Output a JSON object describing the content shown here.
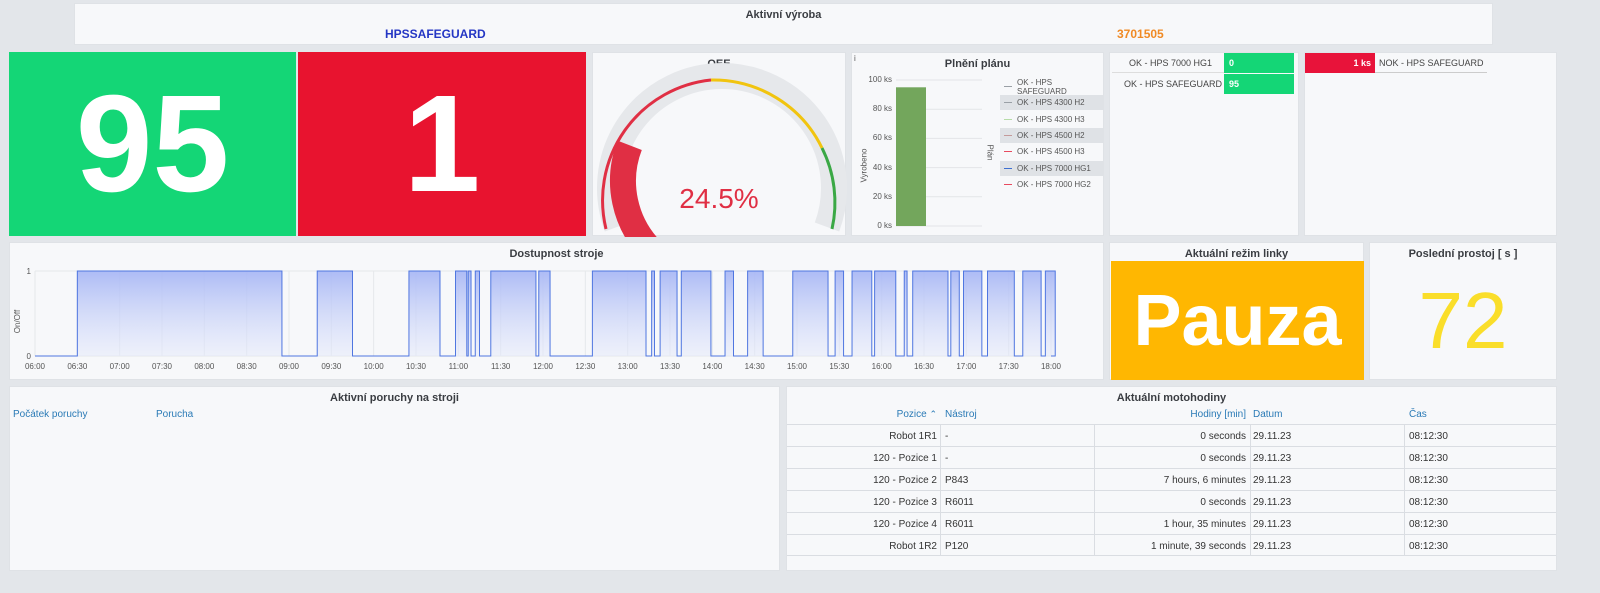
{
  "header": {
    "title": "Aktivní výroba",
    "product": "HPSSAFEGUARD",
    "order": "3701505"
  },
  "stat_ok": {
    "value": "95",
    "color": "#14d676"
  },
  "stat_nok": {
    "value": "1",
    "color": "#e8132f"
  },
  "oee": {
    "title": "OEE",
    "value": "24.5%",
    "percent": 24.5
  },
  "plan": {
    "title": "Plnění plánu",
    "info": "i",
    "ylabel_left": "Vyrobeno",
    "ylabel_right": "Plán",
    "ticks": [
      "100 ks",
      "80 ks",
      "60 ks",
      "40 ks",
      "20 ks",
      "0 ks"
    ],
    "bar_value": 95,
    "ymax": 100,
    "legend": [
      {
        "label": "OK - HPS SAFEGUARD",
        "color": "#9aa0a6",
        "hl": false
      },
      {
        "label": "OK - HPS 4300 H2",
        "color": "#9aa0a6",
        "hl": true
      },
      {
        "label": "OK - HPS 4300 H3",
        "color": "#b7dca8",
        "hl": false
      },
      {
        "label": "OK - HPS 4500 H2",
        "color": "#c49a9a",
        "hl": true
      },
      {
        "label": "OK - HPS 4500 H3",
        "color": "#e84a5f",
        "hl": false
      },
      {
        "label": "OK - HPS 7000 HG1",
        "color": "#3d6fd1",
        "hl": true
      },
      {
        "label": "OK - HPS 7000 HG2",
        "color": "#e84a5f",
        "hl": false
      }
    ]
  },
  "ok_table": {
    "rows": [
      {
        "label": "OK - HPS 7000 HG1",
        "value": "0"
      },
      {
        "label": "OK - HPS SAFEGUARD",
        "value": "95"
      }
    ]
  },
  "nok_table": {
    "rows": [
      {
        "value": "1 ks",
        "label": "NOK - HPS SAFEGUARD"
      }
    ]
  },
  "availability": {
    "title": "Dostupnost stroje",
    "ylabel": "On/Off",
    "yticks": [
      "1",
      "0"
    ],
    "xticks": [
      "06:00",
      "06:30",
      "07:00",
      "07:30",
      "08:00",
      "08:30",
      "09:00",
      "09:30",
      "10:00",
      "10:30",
      "11:00",
      "11:30",
      "12:00",
      "12:30",
      "13:00",
      "13:30",
      "14:00",
      "14:30",
      "15:00",
      "15:30",
      "16:00",
      "16:30",
      "17:00",
      "17:30",
      "18:00"
    ],
    "on_intervals": [
      [
        "06:30",
        "08:55"
      ],
      [
        "09:20",
        "09:45"
      ],
      [
        "10:25",
        "10:47"
      ],
      [
        "10:58",
        "11:06"
      ],
      [
        "11:07",
        "11:09"
      ],
      [
        "11:12",
        "11:15"
      ],
      [
        "11:23",
        "11:55"
      ],
      [
        "11:57",
        "12:05"
      ],
      [
        "12:35",
        "13:13"
      ],
      [
        "13:17",
        "13:19"
      ],
      [
        "13:23",
        "13:35"
      ],
      [
        "13:38",
        "13:59"
      ],
      [
        "14:09",
        "14:15"
      ],
      [
        "14:25",
        "14:36"
      ],
      [
        "14:57",
        "15:22"
      ],
      [
        "15:27",
        "15:33"
      ],
      [
        "15:39",
        "15:53"
      ],
      [
        "15:55",
        "16:10"
      ],
      [
        "16:16",
        "16:18"
      ],
      [
        "16:22",
        "16:47"
      ],
      [
        "16:49",
        "16:55"
      ],
      [
        "16:58",
        "17:11"
      ],
      [
        "17:15",
        "17:34"
      ],
      [
        "17:40",
        "17:53"
      ],
      [
        "17:56",
        "18:03"
      ]
    ]
  },
  "line_mode": {
    "title": "Aktuální režim linky",
    "value": "Pauza",
    "color": "#ffb701"
  },
  "last_downtime": {
    "title": "Poslední prostoj [ s ]",
    "value": "72",
    "color": "#fade2a"
  },
  "faults": {
    "title": "Aktivní poruchy na stroji",
    "col_start": "Počátek poruchy",
    "col_fault": "Porucha"
  },
  "hours": {
    "title": "Aktuální motohodiny",
    "columns": [
      "Pozice",
      "Nástroj",
      "Hodiny [min]",
      "Datum",
      "Čas"
    ],
    "sort_marker": "⌃",
    "rows": [
      [
        "Robot 1R1",
        "-",
        "0 seconds",
        "29.11.23",
        "08:12:30"
      ],
      [
        "120 - Pozice 1",
        "-",
        "0 seconds",
        "29.11.23",
        "08:12:30"
      ],
      [
        "120 - Pozice 2",
        "P843",
        "7 hours, 6 minutes",
        "29.11.23",
        "08:12:30"
      ],
      [
        "120 - Pozice 3",
        "R6011",
        "0 seconds",
        "29.11.23",
        "08:12:30"
      ],
      [
        "120 - Pozice 4",
        "R6011",
        "1 hour, 35 minutes",
        "29.11.23",
        "08:12:30"
      ],
      [
        "Robot 1R2",
        "P120",
        "1 minute, 39 seconds",
        "29.11.23",
        "08:12:30"
      ]
    ]
  }
}
